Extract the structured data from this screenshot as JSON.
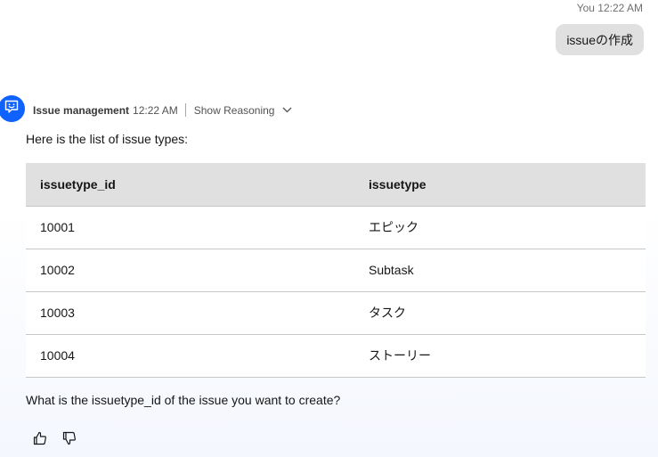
{
  "user_message": {
    "sender": "You",
    "time": "12:22 AM",
    "text": "issueの作成"
  },
  "bot_message": {
    "name": "Issue management",
    "time": "12:22 AM",
    "reasoning_label": "Show Reasoning",
    "intro": "Here is the list of issue types:",
    "table": {
      "headers": [
        "issuetype_id",
        "issuetype"
      ],
      "rows": [
        [
          "10001",
          "エピック"
        ],
        [
          "10002",
          "Subtask"
        ],
        [
          "10003",
          "タスク"
        ],
        [
          "10004",
          "ストーリー"
        ]
      ]
    },
    "question": "What is the issuetype_id of the issue you want to create?"
  },
  "icons": {
    "avatar": "chat-bot-icon",
    "reasoning": "chevron-down-icon",
    "like": "thumbs-up-icon",
    "dislike": "thumbs-down-icon"
  },
  "colors": {
    "accent": "#0f62fe",
    "bubble": "#e0e0e0",
    "table_header": "#e0e0e0"
  }
}
